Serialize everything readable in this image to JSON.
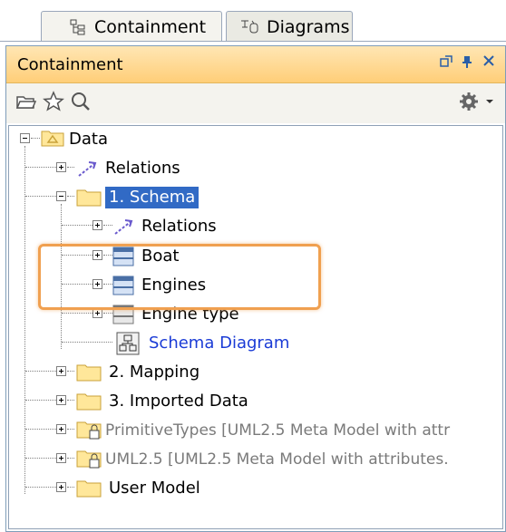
{
  "tabs": [
    {
      "label": "Containment",
      "icon": "containment-tree-icon"
    },
    {
      "label": "Diagrams",
      "icon": "diagrams-icon"
    }
  ],
  "panel": {
    "title": "Containment",
    "title_icons": [
      "float-window-icon",
      "pin-icon",
      "close-icon"
    ]
  },
  "toolbar": {
    "left_icons": [
      "open-folder-icon",
      "favorite-star-icon",
      "search-icon"
    ],
    "right_icons": [
      "settings-gear-icon",
      "dropdown-arrow-icon"
    ]
  },
  "tree": {
    "root": {
      "label": "Data",
      "icon": "model-package-icon",
      "expanded": true
    },
    "items": [
      {
        "label": "Relations",
        "icon": "relations-icon",
        "expanded": false
      },
      {
        "label": "1. Schema",
        "icon": "folder-icon",
        "expanded": true,
        "selected": true
      },
      {
        "label": "Relations",
        "icon": "relations-icon",
        "expanded": false
      },
      {
        "label": "Boat",
        "icon": "table-icon",
        "expanded": false
      },
      {
        "label": "Engines",
        "icon": "table-icon",
        "expanded": false
      },
      {
        "label": "Engine type",
        "icon": "table-icon",
        "expanded": false
      },
      {
        "label": "Schema Diagram",
        "icon": "diagram-icon"
      },
      {
        "label": "2. Mapping",
        "icon": "folder-icon",
        "expanded": false
      },
      {
        "label": "3. Imported Data",
        "icon": "folder-icon",
        "expanded": false
      },
      {
        "label": "PrimitiveTypes [UML2.5 Meta Model with attr",
        "icon": "locked-package-icon",
        "expanded": false
      },
      {
        "label": "UML2.5 [UML2.5 Meta Model with attributes.",
        "icon": "locked-package-icon",
        "expanded": false
      },
      {
        "label": "User Model",
        "icon": "folder-icon",
        "expanded": false
      }
    ]
  },
  "colors": {
    "title_bar": "#ffce78",
    "selection": "#316ac5",
    "highlight_border": "#f0a050",
    "link_text": "#1a3bd6",
    "readonly_text": "#7a7a7a"
  }
}
